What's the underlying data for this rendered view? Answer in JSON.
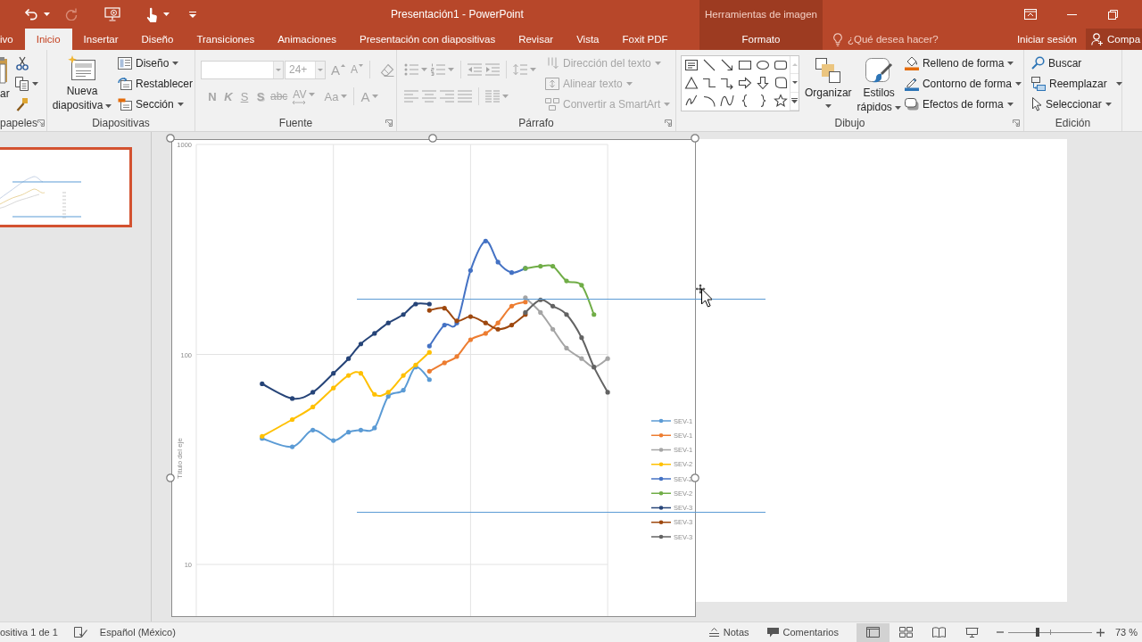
{
  "title_bar": {
    "quick_access": [
      {
        "caret": true,
        "disabled": false
      },
      {
        "caret": false,
        "disabled": true
      },
      {
        "caret": false,
        "disabled": false
      },
      {
        "caret": true,
        "disabled": false
      },
      {
        "caret": false,
        "disabled": false
      }
    ],
    "title": "Presentación1 - PowerPoint",
    "context_header": "Herramientas de imagen"
  },
  "tabs": [
    {
      "label": "ivo",
      "selected": false,
      "contextual": false
    },
    {
      "label": "Inicio",
      "selected": true,
      "contextual": false
    },
    {
      "label": "Insertar",
      "selected": false,
      "contextual": false
    },
    {
      "label": "Diseño",
      "selected": false,
      "contextual": false
    },
    {
      "label": "Transiciones",
      "selected": false,
      "contextual": false
    },
    {
      "label": "Animaciones",
      "selected": false,
      "contextual": false
    },
    {
      "label": "Presentación con diapositivas",
      "selected": false,
      "contextual": false
    },
    {
      "label": "Revisar",
      "selected": false,
      "contextual": false
    },
    {
      "label": "Vista",
      "selected": false,
      "contextual": false
    },
    {
      "label": "Foxit PDF",
      "selected": false,
      "contextual": false
    },
    {
      "label": "Formato",
      "selected": false,
      "contextual": true
    }
  ],
  "tell_me": {
    "placeholder": "¿Qué desea hacer?"
  },
  "account": {
    "sign_in": "Iniciar sesión",
    "share": "Compa"
  },
  "ribbon": [
    {
      "kind": "clipboard",
      "title": "papeles",
      "launcher": true,
      "paste": {
        "label": "ar"
      },
      "tools": [
        {
          "caret": false
        },
        {
          "caret": true
        },
        {
          "caret": false
        }
      ]
    },
    {
      "kind": "slides",
      "title": "Diapositivas",
      "launcher": false,
      "new_slide": {
        "label": "Nueva diapositiva",
        "caret": true
      },
      "buttons": [
        {
          "label": "Diseño",
          "caret": true
        },
        {
          "label": "Restablecer",
          "caret": false
        },
        {
          "label": "Sección",
          "caret": true
        }
      ]
    },
    {
      "kind": "font",
      "title": "Fuente",
      "launcher": true,
      "font_name": {
        "disabled": true
      },
      "font_size": {
        "value": "24+",
        "disabled": true
      },
      "tools_row_1": [
        {
          "label": "A",
          "caret": false,
          "disabled": true
        },
        {
          "label": "A",
          "caret": false,
          "disabled": true
        },
        {
          "caret": false,
          "disabled": true
        }
      ],
      "tools_row_2": [
        {
          "label": "N",
          "caret": false,
          "disabled": true
        },
        {
          "label": "K",
          "caret": false,
          "disabled": true
        },
        {
          "label": "S",
          "caret": false,
          "disabled": true
        },
        {
          "label": "S",
          "caret": false,
          "disabled": true
        },
        {
          "label": "abc",
          "caret": false,
          "disabled": true
        },
        {
          "label": "AV",
          "caret": true,
          "disabled": true
        },
        {
          "label": "Aa",
          "caret": true,
          "disabled": true
        },
        {
          "label": "A",
          "caret": true,
          "disabled": true
        }
      ]
    },
    {
      "kind": "paragraph",
      "title": "Párrafo",
      "launcher": true,
      "tools_row_1": [
        {
          "caret": true,
          "disabled": true
        },
        {
          "caret": true,
          "disabled": true
        },
        {
          "caret": false,
          "disabled": true
        },
        {
          "caret": false,
          "disabled": true
        },
        {
          "caret": true,
          "disabled": true
        }
      ],
      "tools_row_2": [
        {
          "caret": false,
          "disabled": true
        },
        {
          "caret": false,
          "disabled": true
        },
        {
          "caret": false,
          "disabled": true
        },
        {
          "caret": false,
          "disabled": true
        },
        {
          "caret": true,
          "disabled": true
        }
      ],
      "text_buttons": [
        {
          "label": "Dirección del texto",
          "caret": true,
          "disabled": true
        },
        {
          "label": "Alinear texto",
          "caret": true,
          "disabled": true
        },
        {
          "label": "Convertir a SmartArt",
          "caret": true,
          "disabled": true
        }
      ]
    },
    {
      "kind": "drawing",
      "title": "Dibujo",
      "launcher": true,
      "large_buttons": [
        {
          "label": "Organizar",
          "caret": true
        },
        {
          "label": "Estilos rápidos",
          "caret": true
        }
      ],
      "buttons": [
        {
          "label": "Relleno de forma",
          "caret": true
        },
        {
          "label": "Contorno de forma",
          "caret": true
        },
        {
          "label": "Efectos de forma",
          "caret": true
        }
      ]
    },
    {
      "kind": "editing",
      "title": "Edición",
      "launcher": false,
      "buttons": [
        {
          "label": "Buscar",
          "caret": false
        },
        {
          "label": "Reemplazar",
          "caret": true
        },
        {
          "label": "Seleccionar",
          "caret": true
        }
      ]
    }
  ],
  "slides": [
    {
      "selected": true
    }
  ],
  "picture": {
    "selected": true,
    "axis_labels": [
      "1000",
      "100",
      "10"
    ],
    "axis_title": "Título del eje",
    "legend": [
      {
        "label": "SEV-1",
        "color": "#5B9BD5"
      },
      {
        "label": "SEV-1",
        "color": "#ED7D31"
      },
      {
        "label": "SEV-1",
        "color": "#A5A5A5"
      },
      {
        "label": "SEV-2",
        "color": "#FFC000"
      },
      {
        "label": "SEV-2",
        "color": "#4472C4"
      },
      {
        "label": "SEV-2",
        "color": "#70AD47"
      },
      {
        "label": "SEV-3",
        "color": "#264478"
      },
      {
        "label": "SEV-3",
        "color": "#9E480E"
      },
      {
        "label": "SEV-3",
        "color": "#636363"
      }
    ]
  },
  "status_bar": {
    "slide_info": "ositiva 1 de 1",
    "language": "Español (México)",
    "notes": "Notas",
    "comments": "Comentarios",
    "views": [
      {
        "selected": true
      },
      {
        "selected": false
      },
      {
        "selected": false
      },
      {
        "selected": false
      }
    ],
    "zoom": {
      "level": 0.35,
      "reading": "73 %"
    }
  }
}
